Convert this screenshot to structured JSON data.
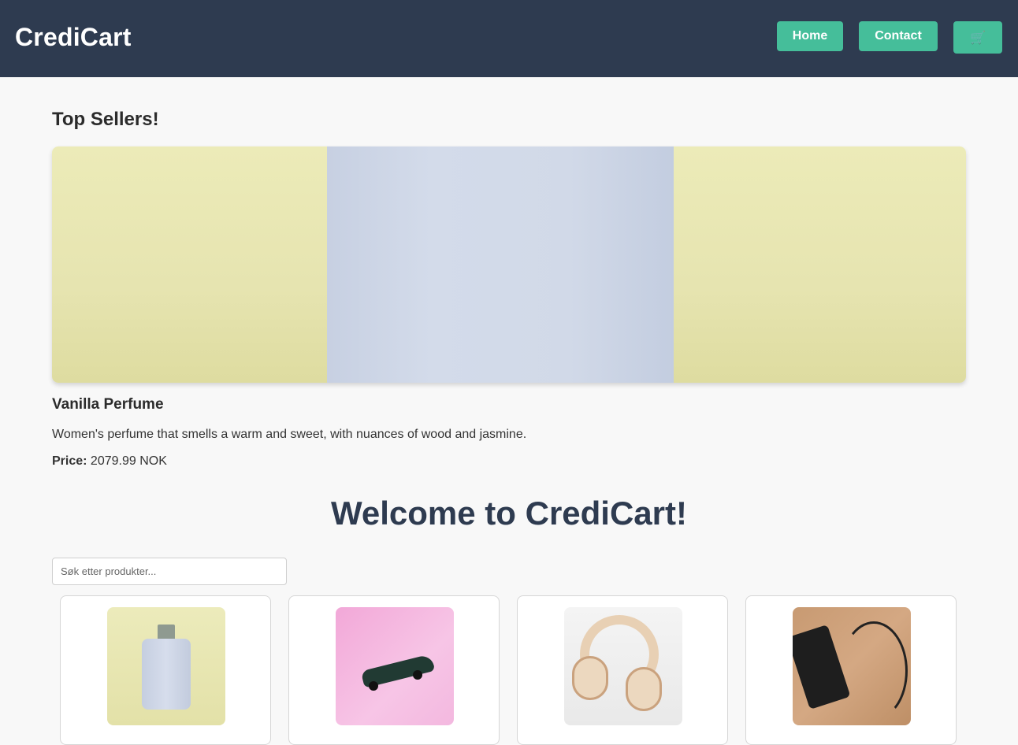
{
  "header": {
    "brand": "CrediCart",
    "nav": {
      "home": "Home",
      "contact": "Contact",
      "cart_icon": "🛒"
    },
    "colors": {
      "background": "#2e3b50",
      "button": "#45be9a"
    }
  },
  "top_sellers": {
    "heading": "Top Sellers!",
    "featured": {
      "image_icon": "perfume-bottle-image",
      "title": "Vanilla Perfume",
      "description": "Women's perfume that smells a warm and sweet, with nuances of wood and jasmine.",
      "price_label": "Price:",
      "price_value": "2079.99 NOK"
    }
  },
  "main": {
    "welcome": "Welcome to CrediCart!",
    "search": {
      "placeholder": "Søk etter produkter...",
      "value": ""
    },
    "products": [
      {
        "image_icon": "perfume-bottle-image"
      },
      {
        "image_icon": "toy-car-image"
      },
      {
        "image_icon": "headphones-image"
      },
      {
        "image_icon": "power-bank-image"
      }
    ]
  }
}
